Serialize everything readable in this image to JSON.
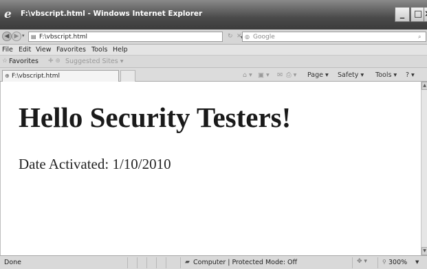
{
  "window": {
    "title": "F:\\vbscript.html - Windows Internet Explorer",
    "min_glyph": "_",
    "max_glyph": "□",
    "close_glyph": "×"
  },
  "nav": {
    "back_glyph": "◀",
    "forward_glyph": "▶",
    "history_glyph": "▾",
    "address": "F:\\vbscript.html",
    "address_drop_glyph": "▼",
    "refresh_glyph": "↻",
    "stop_glyph": "✕",
    "search_placeholder": "Google",
    "search_button_glyph": "⌕"
  },
  "menu": {
    "items": [
      "File",
      "Edit",
      "View",
      "Favorites",
      "Tools",
      "Help"
    ]
  },
  "favorites_bar": {
    "favorites_label": "Favorites",
    "suggested_label": "Suggested Sites ▾"
  },
  "tab": {
    "label": "F:\\vbscript.html"
  },
  "command_bar": {
    "home": "⌂ ▾",
    "feeds": "▣ ▾",
    "read_mail": "✉",
    "print": "⎙ ▾",
    "page": "Page ▾",
    "safety": "Safety ▾",
    "tools": "Tools ▾",
    "help": "? ▾"
  },
  "content": {
    "heading": "Hello Security Testers!",
    "date_line": "Date Activated: 1/10/2010"
  },
  "status": {
    "text": "Done",
    "zone": "Computer | Protected Mode: Off",
    "zoom": "300%"
  },
  "icons": {
    "ie_logo": "ie-logo-icon",
    "page": "page-icon",
    "search_provider": "search-provider-icon",
    "favorites_star": "star-icon",
    "computer_zone": "computer-zone-icon",
    "zoom": "magnifier-icon"
  }
}
